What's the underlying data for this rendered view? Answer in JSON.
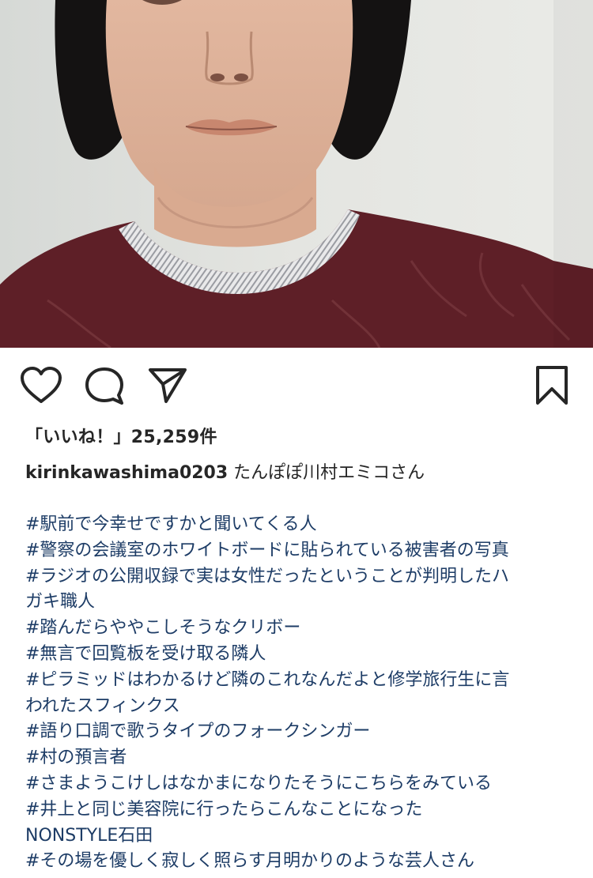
{
  "post": {
    "image_alt": "portrait photo of a woman with a bob haircut wearing a maroon sweater"
  },
  "actions": {
    "like_icon": "heart-icon",
    "comment_icon": "comment-icon",
    "share_icon": "paper-plane-icon",
    "save_icon": "bookmark-icon"
  },
  "likes": {
    "text": "「いいね！」25,259件"
  },
  "caption": {
    "username": "kirinkawashima0203",
    "text": "たんぽぽ川村エミコさん",
    "hashtags": [
      "#駅前で今幸せですかと聞いてくる人",
      "#警察の会議室のホワイトボードに貼られている被害者の写真",
      "#ラジオの公開収録で実は女性だったということが判明したハ",
      "ガキ職人",
      "#踏んだらややこしそうなクリボー",
      "#無言で回覧板を受け取る隣人",
      "#ピラミッドはわかるけど隣のこれなんだよと修学旅行生に言",
      "われたスフィンクス",
      "#語り口調で歌うタイプのフォークシンガー",
      "#村の預言者",
      "#さまようこけしはなかまになりたそうにこちらをみている",
      "#井上と同じ美容院に行ったらこんなことになった",
      "NONSTYLE石田",
      "#その場を優しく寂しく照らす月明かりのような芸人さん"
    ]
  },
  "colors": {
    "hashtag": "#1d3c66",
    "text": "#262626"
  }
}
